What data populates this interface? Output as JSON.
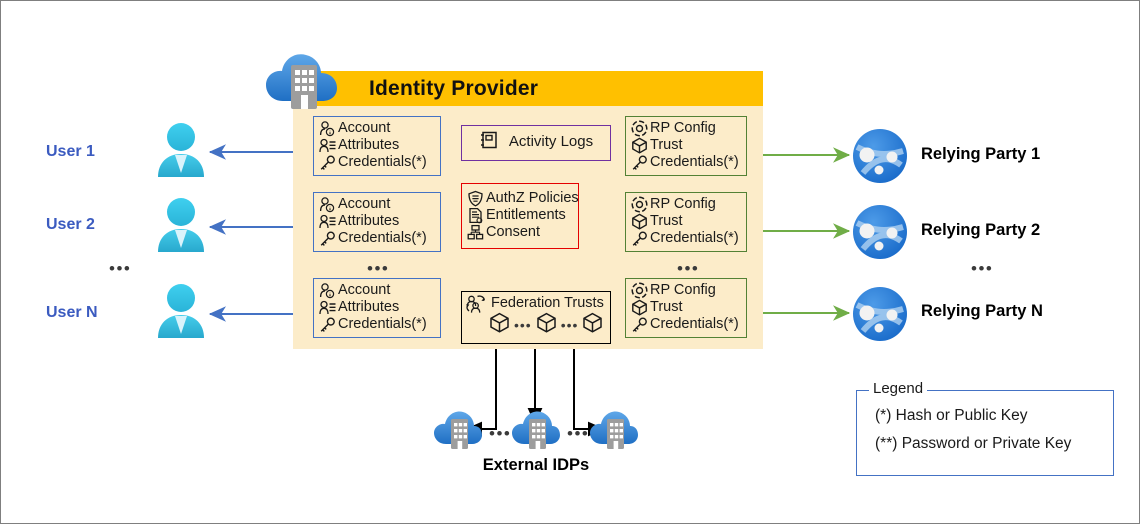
{
  "diagram": {
    "title": "Identity Provider",
    "panel_color": "#fcecc9",
    "header_color": "#ffc000"
  },
  "users": {
    "items": [
      {
        "label": "User 1"
      },
      {
        "label": "User 2"
      },
      {
        "label": "User N"
      }
    ],
    "ellipsis": "•••"
  },
  "relying_parties": {
    "items": [
      {
        "label": "Relying Party 1"
      },
      {
        "label": "Relying Party 2"
      },
      {
        "label": "Relying Party N"
      }
    ],
    "ellipsis": "•••"
  },
  "accounts": {
    "ellipsis": "•••",
    "boxes": [
      {
        "line1": "Account",
        "line2": "Attributes",
        "line3": "Credentials(*)"
      },
      {
        "line1": "Account",
        "line2": "Attributes",
        "line3": "Credentials(*)"
      },
      {
        "line1": "Account",
        "line2": "Attributes",
        "line3": "Credentials(*)"
      }
    ]
  },
  "rp_configs": {
    "ellipsis": "•••",
    "boxes": [
      {
        "line1": "RP Config",
        "line2": "Trust",
        "line3": "Credentials(*)"
      },
      {
        "line1": "RP Config",
        "line2": "Trust",
        "line3": "Credentials(*)"
      },
      {
        "line1": "RP Config",
        "line2": "Trust",
        "line3": "Credentials(*)"
      }
    ]
  },
  "activity_logs": {
    "label": "Activity Logs"
  },
  "authz": {
    "line1": "AuthZ Policies",
    "line2": "Entitlements",
    "line3": "Consent"
  },
  "federation": {
    "label": "Federation Trusts",
    "ellipsis_a": "•••",
    "ellipsis_b": "•••"
  },
  "external_idps": {
    "label": "External IDPs",
    "ellipsis_a": "•••",
    "ellipsis_b": "•••"
  },
  "legend": {
    "title": "Legend",
    "row1": "(*) Hash or Public Key",
    "row2": "(**) Password or Private Key"
  },
  "colors": {
    "user_arrow": "#4472c4",
    "rp_arrow": "#70ad47",
    "account_border": "#4472c4",
    "rpconfig_border": "#538135",
    "authz_border": "#e50000",
    "logs_border": "#7030a0",
    "federation_border": "#000000",
    "user_label": "#3b5bc0"
  }
}
